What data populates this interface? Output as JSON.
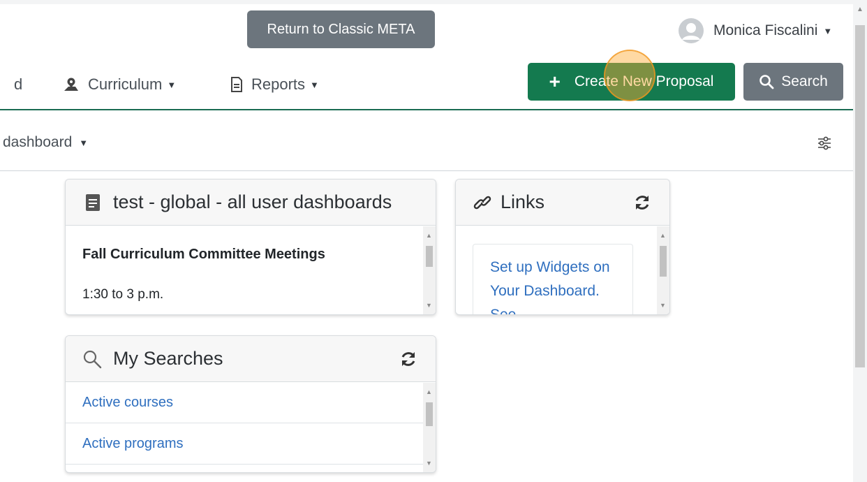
{
  "header": {
    "classic_button_label": "Return to Classic META",
    "user_name": "Monica Fiscalini"
  },
  "nav": {
    "partial_item": "d",
    "items": [
      {
        "label": "Curriculum",
        "icon": "map-pin-icon"
      },
      {
        "label": "Reports",
        "icon": "document-icon"
      }
    ],
    "create_button_label": "Create New Proposal",
    "search_button_label": "Search"
  },
  "dashboard": {
    "selector_label": "dashboard",
    "settings_icon": "sliders-icon"
  },
  "widgets": {
    "announcement": {
      "title": "test - global - all user dashboards",
      "item_title": "Fall Curriculum Committee Meetings",
      "item_time": "1:30 to 3 p.m."
    },
    "links": {
      "title": "Links",
      "link_text": "Set up Widgets on Your Dashboard. See"
    },
    "my_searches": {
      "title": "My Searches",
      "items": [
        "Active courses",
        "Active programs"
      ]
    }
  },
  "colors": {
    "primary_green": "#147a4f",
    "secondary_gray": "#6c757d",
    "link_blue": "#2f6fbf",
    "nav_underline": "#1a6b52"
  }
}
